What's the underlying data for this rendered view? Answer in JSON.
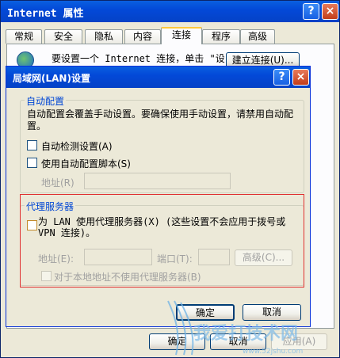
{
  "outer_window": {
    "title": "Internet 属性",
    "help_label": "?",
    "close_label": "×",
    "tabs": [
      "常规",
      "安全",
      "隐私",
      "内容",
      "连接",
      "程序",
      "高级"
    ],
    "active_tab": "连接",
    "connection_text": "要设置一个 Internet 连接，单击 \"设",
    "setup_button": "建立连接(U)...",
    "ok_button": "确定",
    "cancel_button": "取消",
    "apply_button": "应用(A)"
  },
  "lan_dialog": {
    "title": "局域网(LAN)设置",
    "help_label": "?",
    "close_label": "×",
    "auto_config": {
      "group_title": "自动配置",
      "description": "自动配置会覆盖手动设置。要确保使用手动设置，请禁用自动配置。",
      "auto_detect_label": "自动检测设置(A)",
      "auto_script_label": "使用自动配置脚本(S)",
      "address_label": "地址(R)",
      "address_value": ""
    },
    "proxy": {
      "group_title": "代理服务器",
      "use_proxy_label": "为 LAN 使用代理服务器(X) (这些设置不会应用于拨号或VPN 连接)。",
      "address_label": "地址(E):",
      "address_value": "",
      "port_label": "端口(T):",
      "port_value": "",
      "advanced_button": "高级(C)...",
      "bypass_label": "对于本地地址不使用代理服务器(B)"
    },
    "ok_button": "确定",
    "cancel_button": "取消"
  },
  "watermark": {
    "text": "我爱打技术网",
    "url": "www.52jshu.com"
  },
  "colors": {
    "title_bar": "#0349d8",
    "group_title": "#0046d5",
    "highlight_border": "#e03030",
    "dialog_bg": "#ece9d8"
  }
}
